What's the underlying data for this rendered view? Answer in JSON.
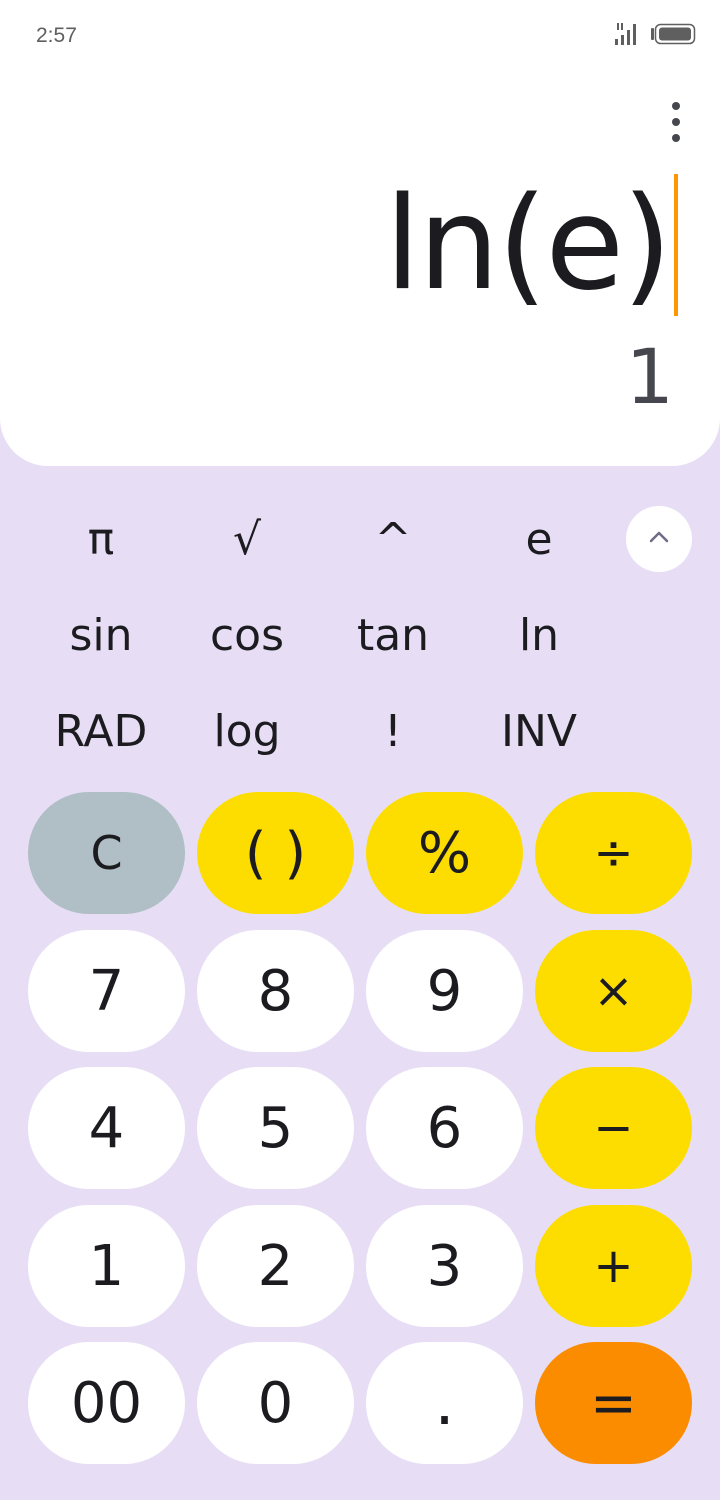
{
  "status": {
    "time": "2:57"
  },
  "display": {
    "expression": "ln(e)",
    "result": "1",
    "colors": {
      "cursor": "#ff9800"
    }
  },
  "scientific": {
    "row1": [
      "π",
      "√",
      "^",
      "e"
    ],
    "row2": [
      "sin",
      "cos",
      "tan",
      "ln"
    ],
    "row3": [
      "RAD",
      "log",
      "!",
      "INV"
    ],
    "collapse_icon": "chevron-up-icon"
  },
  "keypad": {
    "row1": [
      "C",
      "( )",
      "%",
      "÷"
    ],
    "row2": [
      "7",
      "8",
      "9",
      "×"
    ],
    "row3": [
      "4",
      "5",
      "6",
      "−"
    ],
    "row4": [
      "1",
      "2",
      "3",
      "+"
    ],
    "row5": [
      "00",
      "0",
      ".",
      "="
    ]
  },
  "colors": {
    "background": "#e7def6",
    "number_key": "#ffffff",
    "operator_key": "#fddd00",
    "clear_key": "#b0bec5",
    "equals_key": "#fb8c00"
  }
}
